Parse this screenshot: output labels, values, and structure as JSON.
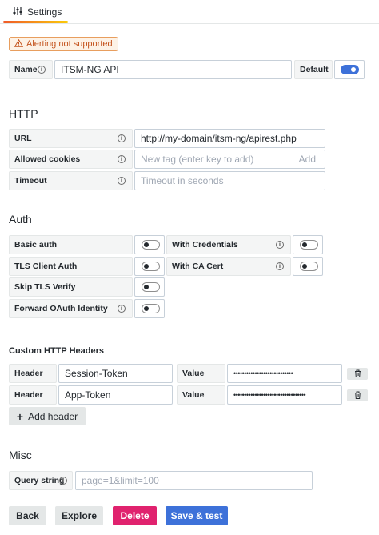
{
  "tabs": {
    "settings_label": "Settings"
  },
  "alert": {
    "text": "Alerting not supported"
  },
  "name_row": {
    "label": "Name",
    "value": "ITSM-NG API",
    "default_label": "Default",
    "default_on": true
  },
  "http": {
    "title": "HTTP",
    "url_label": "URL",
    "url_value": "http://my-domain/itsm-ng/apirest.php",
    "cookies_label": "Allowed cookies",
    "cookies_placeholder": "New tag (enter key to add)",
    "cookies_add": "Add",
    "timeout_label": "Timeout",
    "timeout_placeholder": "Timeout in seconds"
  },
  "auth": {
    "title": "Auth",
    "basic_auth": "Basic auth",
    "with_credentials": "With Credentials",
    "tls_client_auth": "TLS Client Auth",
    "with_ca_cert": "With CA Cert",
    "skip_tls_verify": "Skip TLS Verify",
    "forward_oauth": "Forward OAuth Identity"
  },
  "headers": {
    "title": "Custom HTTP Headers",
    "rows": [
      {
        "header_label": "Header",
        "header_value": "Session-Token",
        "value_label": "Value",
        "value_masked": "••••••••••••••••••••••••••••"
      },
      {
        "header_label": "Header",
        "header_value": "App-Token",
        "value_label": "Value",
        "value_masked": "••••••••••••••••••••••••••••••••••..."
      }
    ],
    "add_label": "Add header"
  },
  "misc": {
    "title": "Misc",
    "query_label": "Query string",
    "query_placeholder": "page=1&limit=100"
  },
  "actions": {
    "back": "Back",
    "explore": "Explore",
    "delete": "Delete",
    "save": "Save & test"
  },
  "colors": {
    "primary": "#3d71d9",
    "danger": "#e0226e",
    "warning": "#c4531d"
  }
}
